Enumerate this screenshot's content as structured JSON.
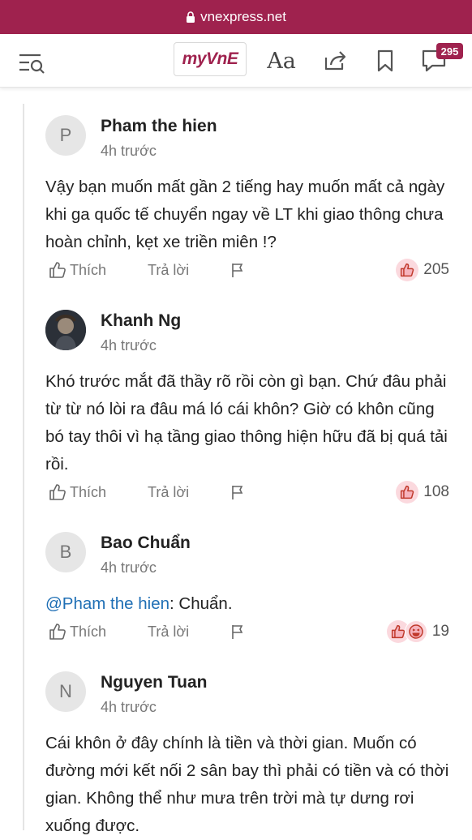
{
  "browser": {
    "url": "vnexpress.net"
  },
  "header": {
    "myvne_label": "myVnE",
    "font_label": "Aa",
    "comment_count": "295"
  },
  "comments": [
    {
      "avatar_letter": "P",
      "name": "Pham the hien",
      "time": "4h trước",
      "text": "Vậy bạn muốn mất gần 2 tiếng hay muốn mất cả ngày khi ga quốc tế chuyển ngay về LT khi giao thông chưa hoàn chỉnh, kẹt xe triền miên !?",
      "like_label": "Thích",
      "reply_label": "Trả lời",
      "reactions": "205"
    },
    {
      "avatar_letter": "",
      "name": "Khanh Ng",
      "time": "4h trước",
      "text": "Khó trước mắt đã thầy rõ rồi còn gì bạn. Chứ đâu phải từ từ nó lòi ra đâu má ló cái khôn? Giờ có khôn cũng bó tay thôi vì hạ tầng giao thông hiện hữu đã bị quá tải rồi.",
      "like_label": "Thích",
      "reply_label": "Trả lời",
      "reactions": "108"
    },
    {
      "avatar_letter": "B",
      "name": "Bao Chuẩn",
      "time": "4h trước",
      "mention": "@Pham the hien",
      "text": ": Chuẩn.",
      "like_label": "Thích",
      "reply_label": "Trả lời",
      "reactions": "19"
    },
    {
      "avatar_letter": "N",
      "name": "Nguyen Tuan",
      "time": "4h trước",
      "text": "Cái khôn ở đây chính là tiền và thời gian. Muốn có đường mới kết nối 2 sân bay thì phải có tiền và có thời gian. Không thể như mưa trên trời mà tự dưng rơi xuống được."
    }
  ],
  "colors": {
    "brand": "#9f224e",
    "mention": "#1f6fb5",
    "reaction_bg": "#fbd9de"
  }
}
